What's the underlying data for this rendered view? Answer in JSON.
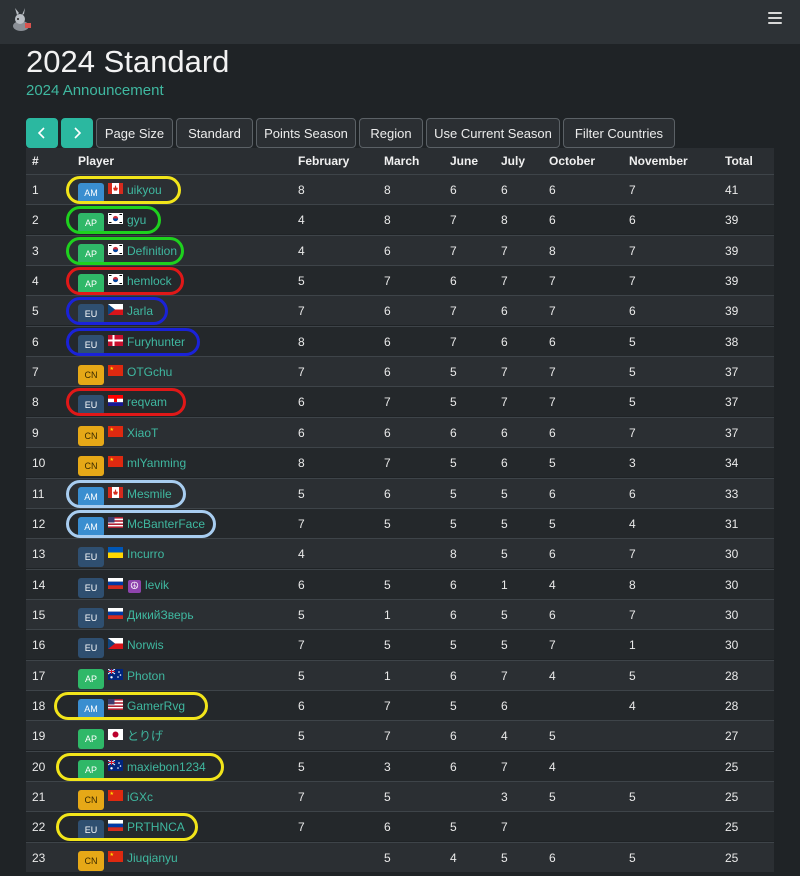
{
  "page": {
    "title": "2024 Standard",
    "announcement_link": "2024 Announcement"
  },
  "colors": {
    "accent": "#2bb8a0",
    "link": "#3fb8a0",
    "ring_yellow": "#f2e51a",
    "ring_green": "#1ed11e",
    "ring_red": "#e01818",
    "ring_blue": "#1a22d8",
    "ring_lightblue": "#a8cdf0"
  },
  "toolbar": {
    "prev_icon": "chevron-left",
    "next_icon": "chevron-right",
    "buttons": [
      "Page Size",
      "Standard",
      "Points Season",
      "Region",
      "Use Current Season",
      "Filter Countries"
    ]
  },
  "table": {
    "columns": [
      "#",
      "Player",
      "February",
      "March",
      "June",
      "July",
      "October",
      "November",
      "Total"
    ],
    "rows": [
      {
        "rank": "1",
        "region": "AM",
        "flag": "CA",
        "name": "uikyou",
        "feb": "8",
        "mar": "8",
        "jun": "6",
        "jul": "6",
        "oct": "6",
        "nov": "7",
        "total": "41",
        "ring": "yellow"
      },
      {
        "rank": "2",
        "region": "AP",
        "flag": "KR",
        "name": "gyu",
        "feb": "4",
        "mar": "8",
        "jun": "7",
        "jul": "8",
        "oct": "6",
        "nov": "6",
        "total": "39",
        "ring": "green"
      },
      {
        "rank": "3",
        "region": "AP",
        "flag": "KR",
        "name": "Definition",
        "feb": "4",
        "mar": "6",
        "jun": "7",
        "jul": "7",
        "oct": "8",
        "nov": "7",
        "total": "39",
        "ring": "green"
      },
      {
        "rank": "4",
        "region": "AP",
        "flag": "KR",
        "name": "hemlock",
        "feb": "5",
        "mar": "7",
        "jun": "6",
        "jul": "7",
        "oct": "7",
        "nov": "7",
        "total": "39",
        "ring": "red"
      },
      {
        "rank": "5",
        "region": "EU",
        "flag": "CZ",
        "name": "Jarla",
        "feb": "7",
        "mar": "6",
        "jun": "7",
        "jul": "6",
        "oct": "7",
        "nov": "6",
        "total": "39",
        "ring": "blue"
      },
      {
        "rank": "6",
        "region": "EU",
        "flag": "DK",
        "name": "Furyhunter",
        "feb": "8",
        "mar": "6",
        "jun": "7",
        "jul": "6",
        "oct": "6",
        "nov": "5",
        "total": "38",
        "ring": "blue"
      },
      {
        "rank": "7",
        "region": "CN",
        "flag": "CN",
        "name": "OTGchu",
        "feb": "7",
        "mar": "6",
        "jun": "5",
        "jul": "7",
        "oct": "7",
        "nov": "5",
        "total": "37",
        "ring": ""
      },
      {
        "rank": "8",
        "region": "EU",
        "flag": "HR",
        "name": "reqvam",
        "feb": "6",
        "mar": "7",
        "jun": "5",
        "jul": "7",
        "oct": "7",
        "nov": "5",
        "total": "37",
        "ring": "red"
      },
      {
        "rank": "9",
        "region": "CN",
        "flag": "CN",
        "name": "XiaoT",
        "feb": "6",
        "mar": "6",
        "jun": "6",
        "jul": "6",
        "oct": "6",
        "nov": "7",
        "total": "37",
        "ring": ""
      },
      {
        "rank": "10",
        "region": "CN",
        "flag": "CN",
        "name": "mlYanming",
        "feb": "8",
        "mar": "7",
        "jun": "5",
        "jul": "6",
        "oct": "5",
        "nov": "3",
        "total": "34",
        "ring": ""
      },
      {
        "rank": "11",
        "region": "AM",
        "flag": "CA",
        "name": "Mesmile",
        "feb": "5",
        "mar": "6",
        "jun": "5",
        "jul": "5",
        "oct": "6",
        "nov": "6",
        "total": "33",
        "ring": "lightblue"
      },
      {
        "rank": "12",
        "region": "AM",
        "flag": "US",
        "name": "McBanterFace",
        "feb": "7",
        "mar": "5",
        "jun": "5",
        "jul": "5",
        "oct": "5",
        "nov": "4",
        "total": "31",
        "ring": "lightblue"
      },
      {
        "rank": "13",
        "region": "EU",
        "flag": "UA",
        "name": "Incurro",
        "feb": "4",
        "mar": "",
        "jun": "8",
        "jul": "5",
        "oct": "6",
        "nov": "7",
        "total": "30",
        "ring": ""
      },
      {
        "rank": "14",
        "region": "EU",
        "flag": "RU",
        "name": "levik",
        "extra_icon": "☮",
        "feb": "6",
        "mar": "5",
        "jun": "6",
        "jul": "1",
        "oct": "4",
        "nov": "8",
        "total": "30",
        "ring": ""
      },
      {
        "rank": "15",
        "region": "EU",
        "flag": "RU",
        "name": "ДикийЗверь",
        "feb": "5",
        "mar": "1",
        "jun": "6",
        "jul": "5",
        "oct": "6",
        "nov": "7",
        "total": "30",
        "ring": ""
      },
      {
        "rank": "16",
        "region": "EU",
        "flag": "CZ",
        "name": "Norwis",
        "feb": "7",
        "mar": "5",
        "jun": "5",
        "jul": "5",
        "oct": "7",
        "nov": "1",
        "total": "30",
        "ring": ""
      },
      {
        "rank": "17",
        "region": "AP",
        "flag": "AU",
        "name": "Photon",
        "feb": "5",
        "mar": "1",
        "jun": "6",
        "jul": "7",
        "oct": "4",
        "nov": "5",
        "total": "28",
        "ring": ""
      },
      {
        "rank": "18",
        "region": "AM",
        "flag": "US",
        "name": "GamerRvg",
        "feb": "6",
        "mar": "7",
        "jun": "5",
        "jul": "6",
        "oct": "",
        "nov": "4",
        "total": "28",
        "ring": "yellow"
      },
      {
        "rank": "19",
        "region": "AP",
        "flag": "JP",
        "name": "とりげ",
        "feb": "5",
        "mar": "7",
        "jun": "6",
        "jul": "4",
        "oct": "5",
        "nov": "",
        "total": "27",
        "ring": ""
      },
      {
        "rank": "20",
        "region": "AP",
        "flag": "AU",
        "name": "maxiebon1234",
        "feb": "5",
        "mar": "3",
        "jun": "6",
        "jul": "7",
        "oct": "4",
        "nov": "",
        "total": "25",
        "ring": "yellow"
      },
      {
        "rank": "21",
        "region": "CN",
        "flag": "CN",
        "name": "iGXc",
        "feb": "7",
        "mar": "5",
        "jun": "",
        "jul": "3",
        "oct": "5",
        "nov": "5",
        "total": "25",
        "ring": ""
      },
      {
        "rank": "22",
        "region": "EU",
        "flag": "RU",
        "name": "PRTHNCA",
        "feb": "7",
        "mar": "6",
        "jun": "5",
        "jul": "7",
        "oct": "",
        "nov": "",
        "total": "25",
        "ring": "yellow"
      },
      {
        "rank": "23",
        "region": "CN",
        "flag": "CN",
        "name": "Jiuqianyu",
        "feb": "",
        "mar": "5",
        "jun": "4",
        "jul": "5",
        "oct": "6",
        "nov": "5",
        "total": "25",
        "ring": ""
      }
    ]
  }
}
